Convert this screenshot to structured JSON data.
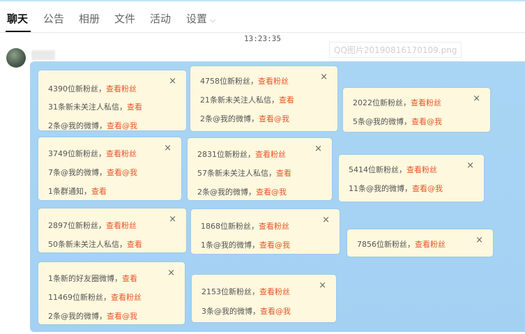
{
  "tabs": [
    {
      "label": "聊天",
      "active": true
    },
    {
      "label": "公告"
    },
    {
      "label": "相册"
    },
    {
      "label": "文件"
    },
    {
      "label": "活动"
    },
    {
      "label": "设置"
    }
  ],
  "settings_chevron": "⌵",
  "timestamp": "13:23:35",
  "filename": "QQ图片20190816170109.png",
  "close_glyph": "×",
  "colors": {
    "accent": "#e8562a",
    "image_bg": "#a9d5f5",
    "card_bg": "#fdf8de"
  },
  "cards": [
    {
      "rows": [
        {
          "text": "4390位新粉丝，",
          "link": "查看粉丝"
        },
        {
          "text": "31条新未关注人私信，",
          "link": "查看"
        },
        {
          "text": "2条@我的微博，",
          "link": "查看@我"
        }
      ]
    },
    {
      "rows": [
        {
          "text": "4758位新粉丝，",
          "link": "查看粉丝"
        },
        {
          "text": "21条新未关注人私信，",
          "link": "查看"
        },
        {
          "text": "2条@我的微博，",
          "link": "查看@我"
        }
      ]
    },
    {
      "rows": [
        {
          "text": "2022位新粉丝，",
          "link": "查看粉丝"
        },
        {
          "text": "5条@我的微博，",
          "link": "查看@我"
        }
      ]
    },
    {
      "rows": [
        {
          "text": "3749位新粉丝，",
          "link": "查看粉丝"
        },
        {
          "text": "7条@我的微博，",
          "link": "查看@我"
        },
        {
          "text": "1条群通知，",
          "link": "查看"
        }
      ]
    },
    {
      "rows": [
        {
          "text": "2831位新粉丝，",
          "link": "查看粉丝"
        },
        {
          "text": "57条新未关注人私信，",
          "link": "查看"
        },
        {
          "text": "2条@我的微博，",
          "link": "查看@我"
        }
      ]
    },
    {
      "rows": [
        {
          "text": "5414位新粉丝，",
          "link": "查看粉丝"
        },
        {
          "text": "11条@我的微博，",
          "link": "查看@我"
        }
      ]
    },
    {
      "rows": [
        {
          "text": "2897位新粉丝，",
          "link": "查看粉丝"
        },
        {
          "text": "50条新未关注人私信，",
          "link": "查看"
        }
      ]
    },
    {
      "rows": [
        {
          "text": "1868位新粉丝，",
          "link": "查看粉丝"
        },
        {
          "text": "1条@我的微博，",
          "link": "查看@我"
        }
      ]
    },
    {
      "rows": [
        {
          "text": "7856位新粉丝，",
          "link": "查看粉丝"
        }
      ]
    },
    {
      "rows": [
        {
          "text": "1条新的好友圈微博，",
          "link": "查看"
        },
        {
          "text": "11469位新粉丝，",
          "link": "查看粉丝"
        },
        {
          "text": "2条@我的微博，",
          "link": "查看@我"
        }
      ]
    },
    {
      "rows": [
        {
          "text": "2153位新粉丝，",
          "link": "查看粉丝"
        },
        {
          "text": "3条@我的微博，",
          "link": "查看@我"
        }
      ]
    }
  ]
}
